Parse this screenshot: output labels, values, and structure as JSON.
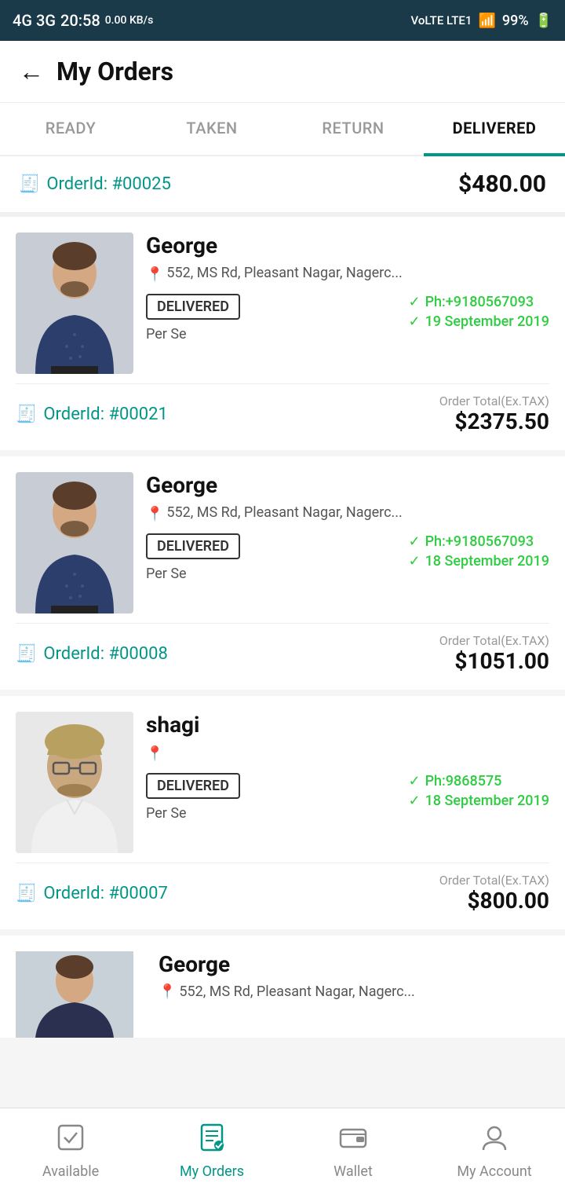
{
  "statusBar": {
    "network": "4G 3G",
    "time": "20:58",
    "dataSpeed": "0.00 KB/s",
    "voLTE": "VoLTE LTE1",
    "wifi": "WiFi",
    "battery": "99%"
  },
  "header": {
    "backLabel": "←",
    "title": "My Orders"
  },
  "tabs": [
    {
      "id": "ready",
      "label": "READY",
      "active": false
    },
    {
      "id": "taken",
      "label": "TAKEN",
      "active": false
    },
    {
      "id": "return",
      "label": "RETURN",
      "active": false
    },
    {
      "id": "delivered",
      "label": "DELIVERED",
      "active": true
    }
  ],
  "summaryOrder": {
    "orderId": "OrderId: #00025",
    "amount": "$480.00"
  },
  "orders": [
    {
      "customerName": "George",
      "address": "552, MS Rd, Pleasant Nagar, Nagerc...",
      "status": "DELIVERED",
      "deliveryBy": "Per Se",
      "phone": "Ph:+9180567093",
      "date": "19 September 2019",
      "orderId": "OrderId: #00021",
      "totalLabel": "Order Total(Ex.TAX)",
      "total": "$2375.50",
      "photoType": "shirt-man"
    },
    {
      "customerName": "George",
      "address": "552, MS Rd, Pleasant Nagar, Nagerc...",
      "status": "DELIVERED",
      "deliveryBy": "Per Se",
      "phone": "Ph:+9180567093",
      "date": "18 September 2019",
      "orderId": "OrderId: #00008",
      "totalLabel": "Order Total(Ex.TAX)",
      "total": "$1051.00",
      "photoType": "shirt-man"
    },
    {
      "customerName": "shagi",
      "address": "",
      "status": "DELIVERED",
      "deliveryBy": "Per Se",
      "phone": "Ph:9868575",
      "date": "18 September 2019",
      "orderId": "OrderId: #00007",
      "totalLabel": "Order Total(Ex.TAX)",
      "total": "$800.00",
      "photoType": "glasses-man"
    }
  ],
  "partialOrder": {
    "customerName": "George",
    "address": "552, MS Rd, Pleasant Nagar, Nagerc..."
  },
  "bottomNav": [
    {
      "id": "available",
      "label": "Available",
      "icon": "☑",
      "active": false
    },
    {
      "id": "my-orders",
      "label": "My Orders",
      "icon": "📋",
      "active": true
    },
    {
      "id": "wallet",
      "label": "Wallet",
      "icon": "👛",
      "active": false
    },
    {
      "id": "my-account",
      "label": "My Account",
      "icon": "👤",
      "active": false
    }
  ]
}
